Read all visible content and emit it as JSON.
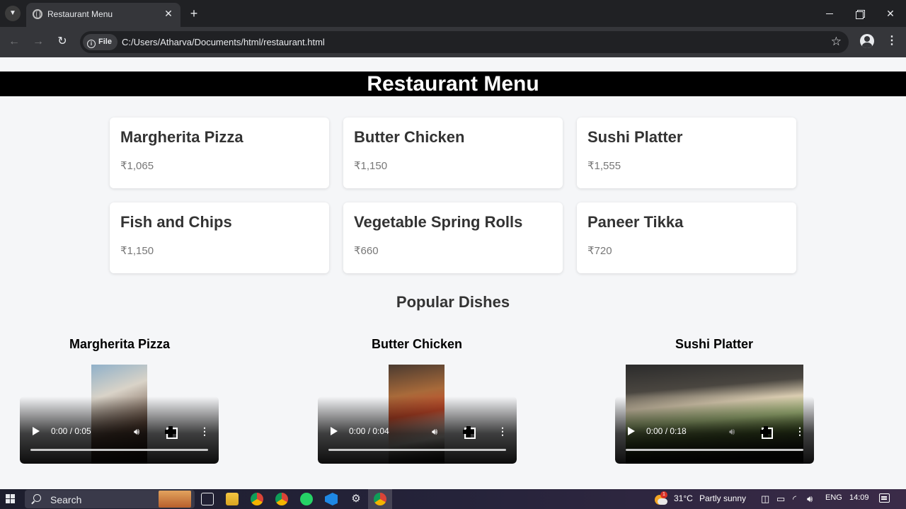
{
  "browser": {
    "tab_title": "Restaurant Menu",
    "site_chip": "File",
    "url": "C:/Users/Atharva/Documents/html/restaurant.html"
  },
  "page": {
    "header": "Restaurant Menu",
    "menu": [
      {
        "name": "Margherita Pizza",
        "price": "₹1,065"
      },
      {
        "name": "Butter Chicken",
        "price": "₹1,150"
      },
      {
        "name": "Sushi Platter",
        "price": "₹1,555"
      },
      {
        "name": "Fish and Chips",
        "price": "₹1,150"
      },
      {
        "name": "Vegetable Spring Rolls",
        "price": "₹660"
      },
      {
        "name": "Paneer Tikka",
        "price": "₹720"
      }
    ],
    "popular_title": "Popular Dishes",
    "videos": [
      {
        "title": "Margherita Pizza",
        "time": "0:00 / 0:05"
      },
      {
        "title": "Butter Chicken",
        "time": "0:00 / 0:04"
      },
      {
        "title": "Sushi Platter",
        "time": "0:00 / 0:18"
      }
    ]
  },
  "taskbar": {
    "search_label": "Search",
    "temperature": "31°C",
    "weather": "Partly sunny",
    "language": "ENG",
    "time": "14:09",
    "weather_badge": "1"
  }
}
